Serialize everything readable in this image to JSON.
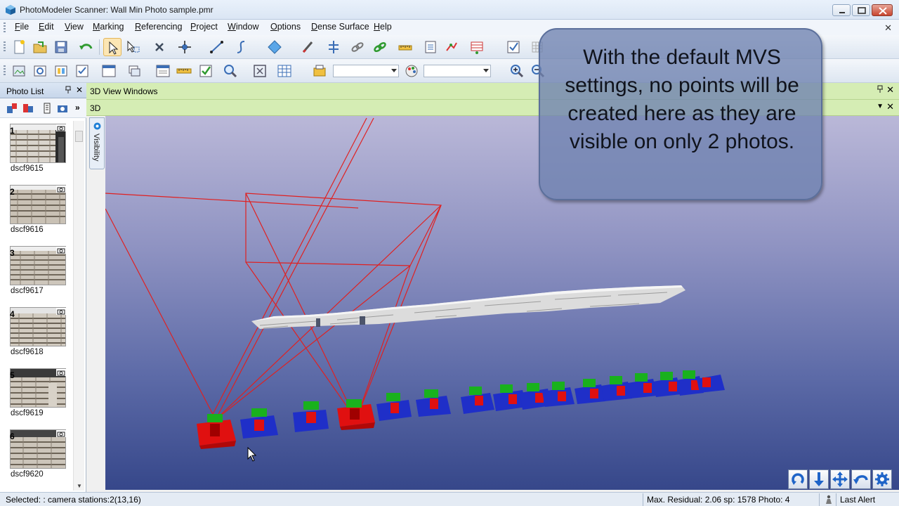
{
  "window": {
    "title": "PhotoModeler Scanner: Wall Min Photo sample.pmr",
    "minimize_glyph": "—",
    "maximize_glyph": "□",
    "close_glyph": "✕"
  },
  "menu": {
    "items": [
      {
        "first": "F",
        "rest": "ile"
      },
      {
        "first": "E",
        "rest": "dit"
      },
      {
        "first": "V",
        "rest": "iew"
      },
      {
        "first": "M",
        "rest": "arking"
      },
      {
        "first": "R",
        "rest": "eferencing"
      },
      {
        "first": "P",
        "rest": "roject"
      },
      {
        "first": "W",
        "rest": "indow"
      },
      {
        "first": "O",
        "rest": "ptions"
      },
      {
        "first": "D",
        "rest": "ense Surface"
      },
      {
        "first": "H",
        "rest": "elp"
      }
    ],
    "close_glyph": "✕"
  },
  "photo_list": {
    "title": "Photo List",
    "pin_glyph": "📌",
    "close_glyph": "✕",
    "more_glyph": "»",
    "photos": [
      {
        "num": "1",
        "name": "dscf9615"
      },
      {
        "num": "2",
        "name": "dscf9616"
      },
      {
        "num": "3",
        "name": "dscf9617"
      },
      {
        "num": "4",
        "name": "dscf9618"
      },
      {
        "num": "5",
        "name": "dscf9619"
      },
      {
        "num": "6",
        "name": "dscf9620"
      }
    ]
  },
  "view_windows": {
    "title": "3D View Windows",
    "tab_label": "3D",
    "visibility_label": "Visibility",
    "pin_glyph": "📌",
    "close_glyph": "✕",
    "dropdown_glyph": "▼"
  },
  "callout": {
    "text": "With the default MVS settings, no points will be created here as they are visible on only 2 photos."
  },
  "status": {
    "selected": "Selected: : camera stations:2(13,16)",
    "residual": "Max. Residual: 2.06 sp: 1578 Photo: 4",
    "alert": "Last Alert"
  },
  "colors": {
    "selected_camera": "#e01010",
    "camera_body": "#1f2fc8",
    "camera_lens": "#e01010",
    "camera_top": "#19b11d",
    "projection_lines": "#e02020",
    "view_header": "#d5edb4"
  }
}
